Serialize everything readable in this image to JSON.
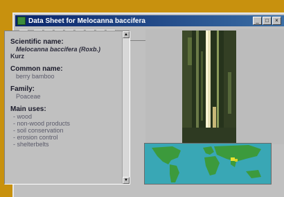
{
  "window": {
    "title": "Data Sheet for Melocanna baccifera",
    "buttons": [
      "_",
      "□",
      "×"
    ]
  },
  "toolbar": {
    "tools": [
      "◀",
      "▣",
      "▦",
      "▤",
      "▥",
      "▧",
      "▨",
      "?",
      "▸"
    ]
  },
  "sheet": {
    "scientific_name_label": "Scientific name:",
    "scientific_name_value": "Melocanna baccifera (Roxb.)",
    "scientific_name_author": "Kurz",
    "common_name_label": "Common name:",
    "common_name_value": "berry bamboo",
    "family_label": "Family:",
    "family_value": "Poaceae",
    "main_uses_label": "Main uses:",
    "main_uses": [
      "wood",
      "non-wood products",
      "soil conservation",
      "erosion control",
      "shelterbelts"
    ]
  },
  "colors": {
    "background": "#c8910e",
    "title_bar": "#0a246a",
    "window": "#c0c0c0",
    "map_water": "#39a7b5",
    "map_land": "#3c9a3c"
  },
  "icons": {
    "app": "bamboo-app-icon",
    "scroll_up": "arrow-up-icon",
    "scroll_down": "arrow-down-icon"
  }
}
